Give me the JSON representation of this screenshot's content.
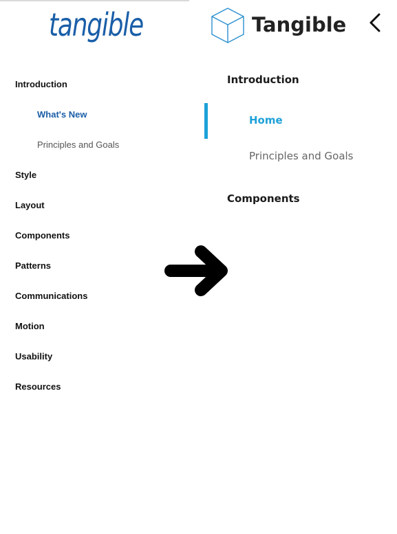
{
  "old_nav": {
    "logo_text": "tangible",
    "items": [
      {
        "label": "Introduction"
      },
      {
        "label": "What's New"
      },
      {
        "label": "Principles and Goals"
      },
      {
        "label": "Style"
      },
      {
        "label": "Layout"
      },
      {
        "label": "Components"
      },
      {
        "label": "Patterns"
      },
      {
        "label": "Communications"
      },
      {
        "label": "Motion"
      },
      {
        "label": "Usability"
      },
      {
        "label": "Resources"
      }
    ],
    "active_item": "What's New",
    "colors": {
      "brand": "#1a5ea8",
      "text": "#111111",
      "muted": "#555555"
    }
  },
  "new_nav": {
    "logo_text": "Tangible",
    "logo_icon": "cube-icon",
    "back_icon": "chevron-left-icon",
    "items": [
      {
        "label": "Introduction"
      },
      {
        "label": "Home"
      },
      {
        "label": "Principles and Goals"
      },
      {
        "label": "Components"
      }
    ],
    "active_item": "Home",
    "colors": {
      "accent": "#1da1d8",
      "text": "#1a1a1a",
      "muted": "#666666"
    }
  },
  "arrow_icon": "arrow-right-icon"
}
